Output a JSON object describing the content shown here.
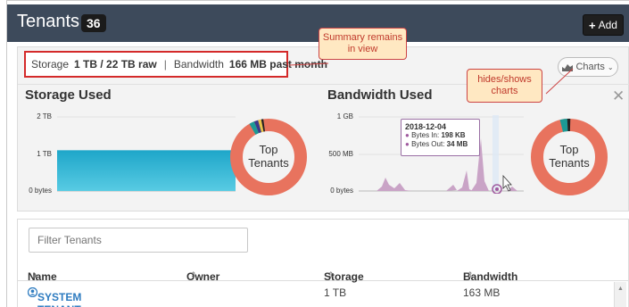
{
  "header": {
    "title": "Tenants",
    "count": "36",
    "add_label": "Add"
  },
  "summary": {
    "storage_label": "Storage",
    "storage_value": "1 TB / 22 TB raw",
    "separator": "|",
    "bandwidth_label": "Bandwidth",
    "bandwidth_value": "166 MB past month",
    "charts_toggle_label": "Charts"
  },
  "callouts": {
    "summary_note": "Summary remains in view",
    "charts_note": "hides/shows charts"
  },
  "storage_chart": {
    "title": "Storage Used",
    "y_ticks": [
      "2 TB",
      "1 TB",
      "0 bytes"
    ],
    "donut_label": "Top Tenants"
  },
  "bandwidth_chart": {
    "title": "Bandwidth Used",
    "y_ticks": [
      "1 GB",
      "500 MB",
      "0 bytes"
    ],
    "donut_label": "Top Tenants",
    "tooltip": {
      "date": "2018-12-04",
      "bytes_in_label": "Bytes In:",
      "bytes_in_value": "198 KB",
      "bytes_out_label": "Bytes Out:",
      "bytes_out_value": "34 MB"
    }
  },
  "chart_data": [
    {
      "type": "area",
      "title": "Storage Used",
      "y_ticks": [
        "2 TB",
        "1 TB",
        "0 bytes"
      ],
      "series": [
        {
          "values": [
            1.1,
            1.1,
            1.1,
            1.1
          ]
        }
      ],
      "ylim": [
        0,
        2
      ]
    },
    {
      "type": "area",
      "title": "Bandwidth Used",
      "y_ticks": [
        "1 GB",
        "500 MB",
        "0 bytes"
      ],
      "ylim": [
        0,
        1000
      ]
    }
  ],
  "filter": {
    "placeholder": "Filter Tenants"
  },
  "table": {
    "columns": [
      "Name",
      "Owner",
      "Storage",
      "Bandwidth"
    ],
    "rows": [
      {
        "name": "SYSTEM TENANT",
        "owner": "",
        "storage": "1 TB",
        "bandwidth": "163 MB"
      }
    ]
  },
  "colors": {
    "header_bg": "#3d4a5b",
    "storage_fill": "#1ea6c9",
    "bandwidth_fill": "#c9a3c6",
    "donut_main": "#e8735e",
    "link": "#2d7bc0",
    "callout_border": "#cc4444"
  }
}
